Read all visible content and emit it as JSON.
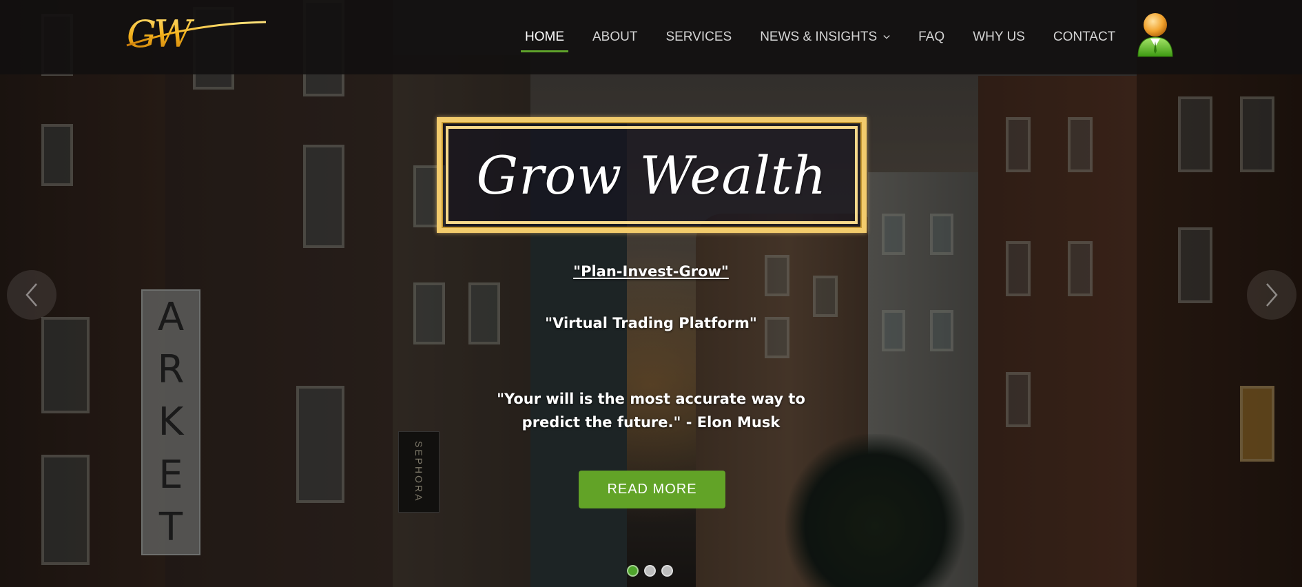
{
  "brand": {
    "logo_text": "GW",
    "title": "Grow Wealth"
  },
  "nav": {
    "items": [
      {
        "label": "HOME",
        "active": true
      },
      {
        "label": "ABOUT",
        "active": false
      },
      {
        "label": "SERVICES",
        "active": false
      },
      {
        "label": "NEWS & INSIGHTS",
        "active": false,
        "has_dropdown": true
      },
      {
        "label": "FAQ",
        "active": false
      },
      {
        "label": "WHY US",
        "active": false
      },
      {
        "label": "CONTACT",
        "active": false
      }
    ],
    "user_icon": "user-avatar-icon"
  },
  "hero": {
    "tagline_1": "\"Plan-Invest-Grow\"",
    "tagline_2": "\"Virtual Trading Platform\"",
    "quote": "\"Your will is the most accurate way to predict the future.\" - Elon Musk",
    "cta_label": "READ MORE",
    "background_signs": {
      "arket": [
        "A",
        "R",
        "K",
        "E",
        "T"
      ],
      "sephora": "SEPHORA"
    }
  },
  "carousel": {
    "prev_icon": "chevron-left-icon",
    "next_icon": "chevron-right-icon",
    "slides": 3,
    "active_slide": 1
  },
  "colors": {
    "accent_green": "#62a327",
    "gold_frame": "#f2cb6c",
    "navbar_bg": "#12100f"
  }
}
